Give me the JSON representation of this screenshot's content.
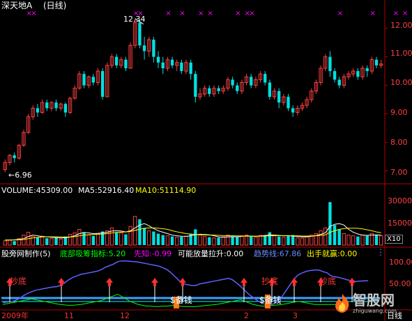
{
  "colors": {
    "background": "#000000",
    "axis_line": "#b40000",
    "grid": "#550000",
    "up": "#ff4040",
    "down": "#00e0e0",
    "ma5": "#ffffff",
    "ma10": "#ffff00",
    "trend": "#6060ff",
    "signal_bar": "#ff7a1a",
    "arrow": "#ff3030",
    "label_red": "#ff3a3a",
    "green": "#00ff00",
    "magenta": "#ff00ff",
    "bottom_band": "#3aa0ff",
    "date_text": "#ff3030",
    "watermark": "#c8c8c8"
  },
  "header": {
    "stock_name": "深天地A",
    "period": "(日线)"
  },
  "price_panel": {
    "y_ticks": [
      "12.00",
      "11.00",
      "10.00",
      "9.00",
      "8.00",
      "7.00"
    ],
    "high_label": "12.34",
    "low_label": "←6.96",
    "marker_glyph": "×"
  },
  "volume_panel": {
    "volume_label": "VOLUME:45309.00",
    "ma5_label": "MA5:52916.40",
    "ma10_label": "MA10:51114.90",
    "y_ticks": [
      "30000",
      "15000"
    ],
    "unit_badge": "X10"
  },
  "indicator_panel": {
    "name": "股旁网制作(5)",
    "bottom_absorb": "底部吸筹指标:5.20",
    "foreknow": "先知:-0.99",
    "volume_breakout": "可能放量拉升:0.00",
    "trend_line": "趋势线:67.86",
    "strike": "出手就赢:0.00",
    "y_ticks": [
      "100.00",
      "50.00"
    ],
    "dollar_labels": [
      "$备钱",
      "$备钱"
    ],
    "buy_labels": [
      "抄底",
      "抄底",
      "抄底"
    ]
  },
  "date_axis": {
    "labels": [
      "2009年",
      "11",
      "12",
      "2",
      "3"
    ],
    "period_tab": "日线"
  },
  "watermark": {
    "cn": "智股网",
    "en": "zhiguwang.com"
  },
  "chart_data": {
    "type": "candlestick",
    "price": {
      "ylim": [
        6.6,
        12.6
      ],
      "high": 12.34,
      "low": 6.96,
      "candles": [
        [
          7.05,
          7.3,
          6.96,
          7.4
        ],
        [
          7.3,
          7.55,
          7.2,
          7.6
        ],
        [
          7.55,
          7.45,
          7.3,
          7.65
        ],
        [
          7.45,
          7.9,
          7.4,
          7.95
        ],
        [
          7.9,
          8.35,
          7.85,
          8.45
        ],
        [
          8.35,
          8.9,
          8.3,
          9.0
        ],
        [
          8.9,
          9.2,
          8.8,
          9.3
        ],
        [
          9.2,
          9.05,
          8.9,
          9.35
        ],
        [
          9.05,
          9.4,
          9.0,
          9.5
        ],
        [
          9.4,
          9.2,
          9.1,
          9.5
        ],
        [
          9.2,
          9.4,
          9.1,
          9.45
        ],
        [
          9.4,
          9.2,
          9.1,
          9.5
        ],
        [
          9.2,
          9.35,
          9.1,
          9.4
        ],
        [
          9.35,
          9.05,
          8.9,
          9.4
        ],
        [
          9.05,
          9.55,
          9.0,
          9.6
        ],
        [
          9.55,
          9.9,
          9.5,
          10.0
        ],
        [
          9.9,
          10.4,
          9.85,
          10.5
        ],
        [
          10.4,
          10.0,
          9.9,
          10.5
        ],
        [
          10.0,
          10.3,
          9.9,
          10.35
        ],
        [
          10.3,
          10.1,
          10.0,
          10.4
        ],
        [
          10.1,
          10.5,
          10.0,
          10.6
        ],
        [
          10.5,
          9.6,
          9.5,
          10.6
        ],
        [
          9.6,
          10.7,
          9.6,
          10.8
        ],
        [
          10.7,
          11.0,
          10.6,
          11.1
        ],
        [
          11.0,
          10.7,
          10.6,
          11.1
        ],
        [
          10.7,
          10.9,
          10.6,
          11.0
        ],
        [
          10.9,
          10.6,
          10.5,
          11.0
        ],
        [
          10.6,
          11.4,
          10.6,
          11.5
        ],
        [
          11.4,
          12.2,
          11.3,
          12.34
        ],
        [
          12.2,
          11.4,
          11.3,
          12.3
        ],
        [
          11.4,
          11.2,
          10.9,
          11.7
        ],
        [
          11.2,
          11.6,
          11.0,
          11.7
        ],
        [
          11.6,
          11.0,
          10.8,
          11.7
        ],
        [
          11.0,
          10.8,
          10.6,
          11.2
        ],
        [
          10.8,
          10.6,
          10.4,
          11.0
        ],
        [
          10.6,
          10.9,
          10.5,
          11.0
        ],
        [
          10.9,
          10.7,
          10.6,
          11.0
        ],
        [
          10.7,
          10.8,
          10.5,
          10.9
        ],
        [
          10.8,
          10.5,
          10.4,
          10.9
        ],
        [
          10.5,
          10.8,
          10.4,
          10.9
        ],
        [
          10.8,
          10.4,
          10.2,
          10.9
        ],
        [
          10.4,
          9.6,
          9.4,
          10.5
        ],
        [
          9.6,
          9.7,
          9.5,
          9.9
        ],
        [
          9.7,
          9.9,
          9.6,
          10.0
        ],
        [
          9.9,
          9.7,
          9.6,
          10.0
        ],
        [
          9.7,
          9.9,
          9.6,
          10.0
        ],
        [
          9.9,
          9.8,
          9.7,
          10.0
        ],
        [
          9.8,
          9.9,
          9.7,
          10.0
        ],
        [
          9.9,
          10.2,
          9.8,
          10.3
        ],
        [
          10.2,
          10.0,
          9.9,
          10.3
        ],
        [
          10.0,
          9.8,
          9.7,
          10.1
        ],
        [
          9.8,
          10.1,
          9.7,
          10.2
        ],
        [
          10.1,
          10.3,
          10.0,
          10.4
        ],
        [
          10.3,
          10.0,
          9.9,
          10.4
        ],
        [
          10.0,
          10.2,
          9.9,
          10.3
        ],
        [
          10.2,
          10.4,
          10.1,
          10.5
        ],
        [
          10.4,
          10.1,
          10.0,
          10.5
        ],
        [
          10.1,
          9.6,
          9.5,
          10.2
        ],
        [
          9.6,
          9.8,
          9.5,
          9.9
        ],
        [
          9.8,
          9.4,
          9.2,
          9.9
        ],
        [
          9.4,
          9.6,
          9.3,
          9.7
        ],
        [
          9.6,
          9.2,
          9.1,
          9.7
        ],
        [
          9.2,
          9.05,
          8.9,
          9.3
        ],
        [
          9.05,
          9.2,
          8.95,
          9.3
        ],
        [
          9.2,
          9.3,
          9.1,
          9.4
        ],
        [
          9.3,
          9.5,
          9.2,
          9.6
        ],
        [
          9.5,
          9.8,
          9.4,
          9.9
        ],
        [
          9.8,
          10.1,
          9.7,
          10.2
        ],
        [
          10.1,
          10.6,
          10.0,
          10.7
        ],
        [
          10.6,
          11.0,
          10.5,
          11.1
        ],
        [
          11.0,
          10.5,
          10.3,
          11.2
        ],
        [
          10.5,
          10.2,
          10.1,
          10.6
        ],
        [
          10.2,
          10.0,
          9.9,
          10.3
        ],
        [
          10.0,
          10.3,
          9.9,
          10.4
        ],
        [
          10.3,
          10.4,
          10.2,
          10.5
        ],
        [
          10.4,
          10.5,
          10.3,
          10.6
        ],
        [
          10.5,
          10.3,
          10.2,
          10.6
        ],
        [
          10.3,
          10.6,
          10.2,
          10.7
        ],
        [
          10.6,
          10.5,
          10.3,
          10.7
        ],
        [
          10.5,
          10.9,
          10.4,
          11.0
        ],
        [
          10.9,
          10.7,
          10.6,
          11.0
        ],
        [
          10.7,
          10.75,
          10.6,
          10.9
        ]
      ]
    },
    "volume": {
      "ylim": [
        0,
        34000
      ],
      "values": [
        3000,
        3500,
        2800,
        4500,
        7000,
        9000,
        6000,
        5500,
        6200,
        4800,
        4500,
        5000,
        4200,
        6000,
        7500,
        8500,
        11000,
        9000,
        7000,
        6500,
        8000,
        9500,
        10000,
        12000,
        9000,
        8500,
        7500,
        13000,
        20000,
        18000,
        12000,
        10000,
        9500,
        8000,
        7000,
        6500,
        6000,
        5500,
        5800,
        6200,
        8000,
        11000,
        7000,
        6000,
        5500,
        5000,
        5200,
        5800,
        7000,
        6000,
        5500,
        6500,
        7000,
        6000,
        5500,
        6800,
        7000,
        9000,
        6500,
        6000,
        5500,
        6500,
        7000,
        5000,
        4800,
        6000,
        7000,
        8000,
        10000,
        12000,
        30000,
        14000,
        11000,
        8000,
        7000,
        6500,
        6000,
        7000,
        6500,
        8000,
        7000,
        6500
      ],
      "ma5": [
        3500,
        3600,
        3700,
        4000,
        4500,
        6000,
        7000,
        6500,
        6000,
        5800,
        5500,
        5200,
        5000,
        5100,
        5600,
        6500,
        8000,
        8800,
        8500,
        8000,
        8200,
        8500,
        9000,
        9800,
        10000,
        9800,
        9200,
        10000,
        12000,
        14000,
        15000,
        13500,
        11500,
        10000,
        9000,
        8000,
        7000,
        6500,
        6200,
        6100,
        6500,
        7300,
        7600,
        7400,
        7200,
        6500,
        5800,
        5500,
        5700,
        5900,
        5800,
        6100,
        6400,
        6300,
        6200,
        6300,
        6700,
        7200,
        7000,
        6800,
        6500,
        6600,
        6300,
        6000,
        5800,
        5800,
        6100,
        6700,
        7500,
        8600,
        13000,
        14500,
        15000,
        14000,
        11000,
        9000,
        7700,
        7000,
        6800,
        7000,
        7100,
        7000
      ],
      "ma10": [
        3500,
        3550,
        3600,
        3700,
        3900,
        4500,
        5000,
        5400,
        5700,
        5800,
        5800,
        5800,
        5700,
        5600,
        5700,
        5900,
        6500,
        7000,
        7300,
        7500,
        7600,
        7700,
        8000,
        8500,
        8900,
        9100,
        9200,
        9500,
        10300,
        11000,
        11800,
        12000,
        12000,
        11800,
        11400,
        11000,
        10000,
        9300,
        8700,
        8000,
        7700,
        7500,
        7300,
        7100,
        7000,
        7000,
        6800,
        6600,
        6500,
        6500,
        6400,
        6300,
        6200,
        6200,
        6200,
        6200,
        6300,
        6500,
        6600,
        6600,
        6600,
        6600,
        6500,
        6400,
        6300,
        6300,
        6300,
        6500,
        6800,
        7100,
        9000,
        10000,
        11000,
        11500,
        11800,
        11800,
        11700,
        11300,
        10700,
        10000,
        9200,
        8700
      ]
    },
    "indicator": {
      "ylim": [
        0,
        130
      ],
      "trend_line": [
        15,
        16,
        17,
        20,
        25,
        32,
        38,
        42,
        46,
        48,
        50,
        52,
        54,
        55,
        58,
        64,
        72,
        78,
        82,
        86,
        88,
        90,
        92,
        94,
        98,
        104,
        108,
        112,
        118,
        120,
        120,
        119,
        118,
        117,
        115,
        113,
        111,
        109,
        107,
        103,
        98,
        90,
        80,
        70,
        62,
        60,
        58,
        58,
        62,
        64,
        66,
        68,
        70,
        72,
        74,
        76,
        72,
        64,
        55,
        45,
        35,
        28,
        20,
        14,
        10,
        9,
        12,
        20,
        30,
        45,
        60,
        75,
        85,
        90,
        94,
        96,
        97,
        97,
        93,
        90,
        82,
        80,
        78,
        75,
        72,
        70,
        68,
        69,
        70,
        70
      ],
      "green_line": [
        10,
        12,
        14,
        16,
        18,
        20,
        22,
        24,
        22,
        20,
        18,
        16,
        14,
        12,
        10,
        9,
        8,
        8,
        9,
        10,
        12,
        14,
        16,
        18,
        20,
        24,
        28,
        32,
        36,
        30,
        24,
        18,
        14,
        10,
        8,
        6,
        6,
        5,
        5,
        6,
        6,
        7,
        8,
        6,
        5,
        5,
        5,
        5,
        6,
        7,
        8,
        9,
        10,
        12,
        14,
        16,
        18,
        20,
        22,
        18,
        14,
        10,
        8,
        6,
        6,
        7,
        8,
        9,
        10,
        12,
        14,
        16,
        18,
        16,
        14,
        12,
        10,
        10,
        10,
        10,
        10,
        10
      ],
      "signal_bars": [
        {
          "i": 54,
          "v": 30
        },
        {
          "i": 82,
          "v": 35
        }
      ],
      "bar_values": [
        30,
        35
      ],
      "arrow_indices": [
        4,
        20,
        35,
        50,
        70,
        78,
        82,
        92,
        102,
        110
      ]
    }
  }
}
